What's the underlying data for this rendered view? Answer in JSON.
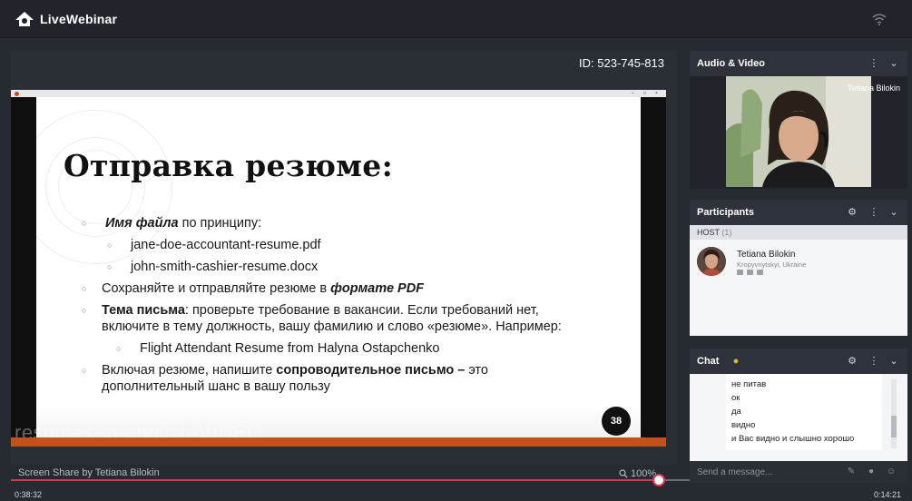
{
  "app": {
    "name": "LiveWebinar"
  },
  "stage": {
    "meeting_id": "ID: 523-745-813",
    "share_caption": "Screen Share by Tetiana Bilokin",
    "zoom": "100%",
    "watermark": "resumes-in-english-VIDEO"
  },
  "slide": {
    "title": "Отправка резюме:",
    "page_number": "38",
    "b1_bold": "Имя файла",
    "b1_rest": " по принципу:",
    "b1a": "jane-doe-accountant-resume.pdf",
    "b1b": "john-smith-cashier-resume.docx",
    "b2_text": "Сохраняйте и отправляйте резюме в ",
    "b2_bold": "формате PDF",
    "b3_bold": "Тема письма",
    "b3_line1": ": проверьте требование в вакансии. Если требований нет,",
    "b3_line2": "включите в тему должность, вашу фамилию и слово «резюме». Например:",
    "b3a": "Flight Attendant Resume from Halyna Ostapchenko",
    "b4_text": " Включая резюме, напишите ",
    "b4_bold": "сопроводительное письмо –",
    "b4_rest": " это",
    "b4_line2": "дополнительный шанс в вашу пользу"
  },
  "timeline": {
    "elapsed": "0:38:32",
    "remaining": "0:14:21",
    "progress_percent": 72.8
  },
  "audio_video": {
    "title": "Audio & Video",
    "speaker": "Tetiana Bilokin"
  },
  "participants": {
    "title": "Participants",
    "host_label": "HOST",
    "host_count": "(1)",
    "host": {
      "name": "Tetiana Bilokin",
      "location": "Kropyvnytskyi, Ukraine"
    }
  },
  "chat": {
    "title": "Chat",
    "messages": [
      "не питав",
      "ок",
      "да",
      "видно",
      "и Вас видно и слышно хорошо"
    ],
    "placeholder": "Send a message..."
  },
  "colors": {
    "accent": "#e4324a",
    "panel": "#2e333b",
    "ppt_status": "#c4501c"
  }
}
